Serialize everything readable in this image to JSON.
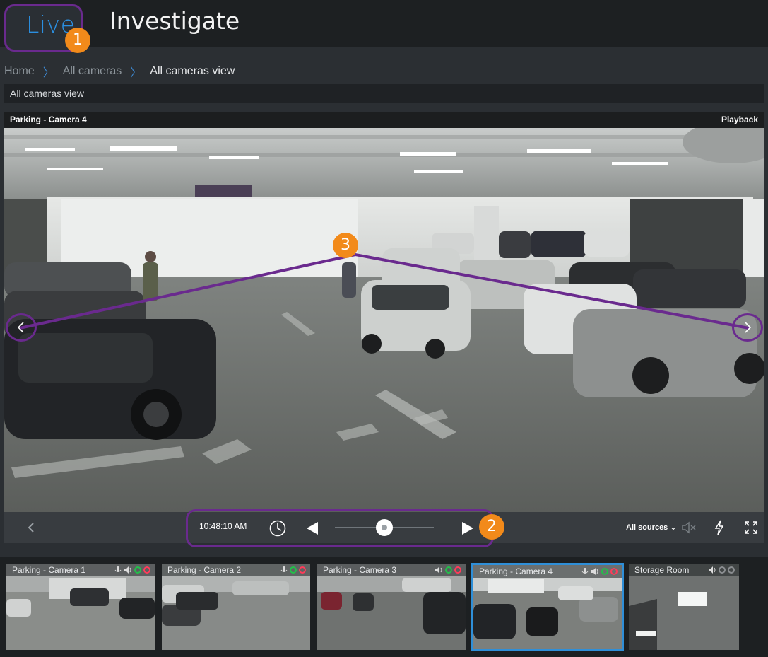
{
  "nav": {
    "live": "Live",
    "investigate": "Investigate"
  },
  "badges": {
    "one": "1",
    "two": "2",
    "three": "3"
  },
  "breadcrumb": {
    "home": "Home",
    "all_cameras": "All cameras",
    "current": "All cameras view"
  },
  "view_title": "All cameras view",
  "main_video": {
    "title": "Parking - Camera 4",
    "playback": "Playback"
  },
  "controls": {
    "time": "10:48:10 AM",
    "sources": "All sources"
  },
  "thumbnails": [
    {
      "name": "Parking - Camera 1"
    },
    {
      "name": "Parking - Camera 2"
    },
    {
      "name": "Parking - Camera 3"
    },
    {
      "name": "Parking - Camera 4"
    },
    {
      "name": "Storage Room"
    }
  ],
  "colors": {
    "accent": "#2b8fe0",
    "highlight": "#6a2a8e",
    "badge": "#f28a1a",
    "selected": "#2f8fd8"
  }
}
